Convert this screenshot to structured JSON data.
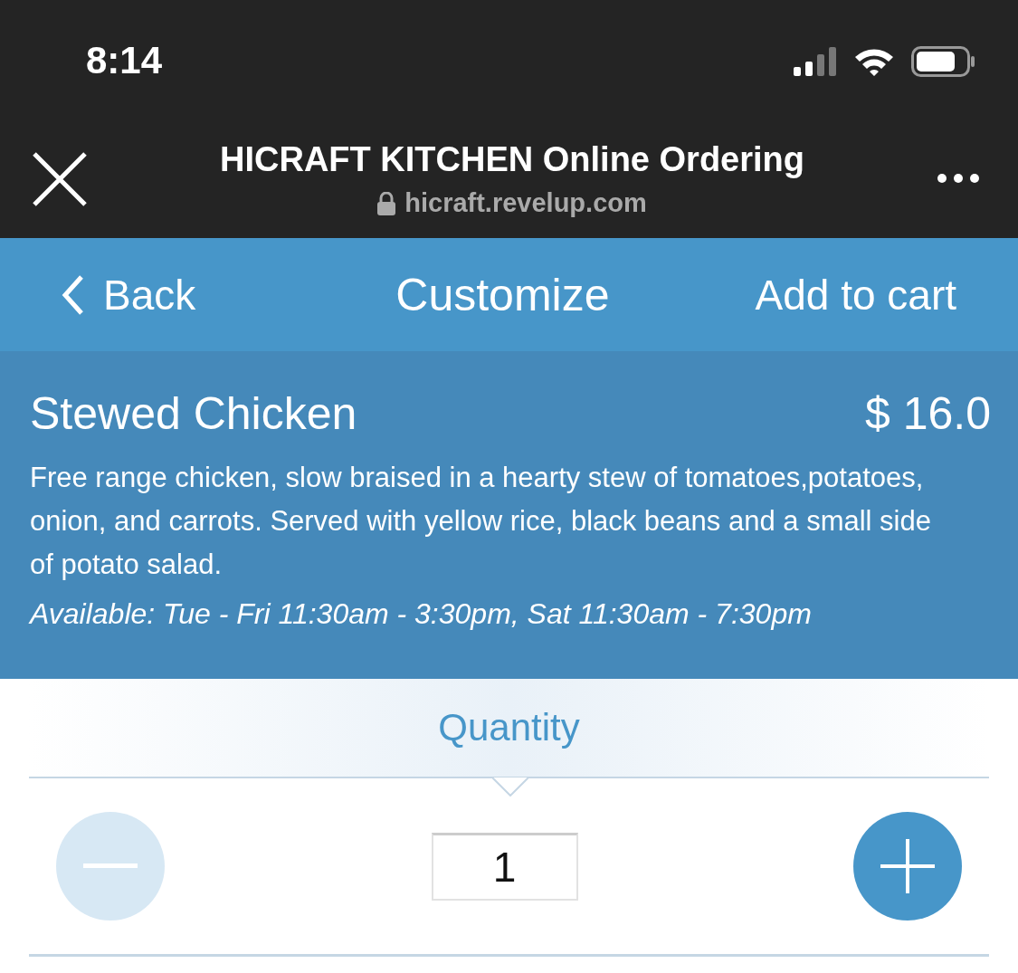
{
  "status_bar": {
    "time": "8:14"
  },
  "browser": {
    "title": "HICRAFT KITCHEN Online Ordering",
    "url": "hicraft.revelup.com"
  },
  "nav": {
    "back": "Back",
    "title": "Customize",
    "action": "Add to cart"
  },
  "item": {
    "name": "Stewed Chicken",
    "price": "$ 16.0",
    "description": "Free range chicken, slow braised in a hearty stew of tomatoes,potatoes, onion, and carrots. Served with yellow rice, black beans and a small side of potato salad.",
    "availability": "Available: Tue - Fri 11:30am - 3:30pm, Sat 11:30am - 7:30pm"
  },
  "quantity": {
    "label": "Quantity",
    "value": "1",
    "decrement_disabled": true,
    "increment_disabled": false
  }
}
